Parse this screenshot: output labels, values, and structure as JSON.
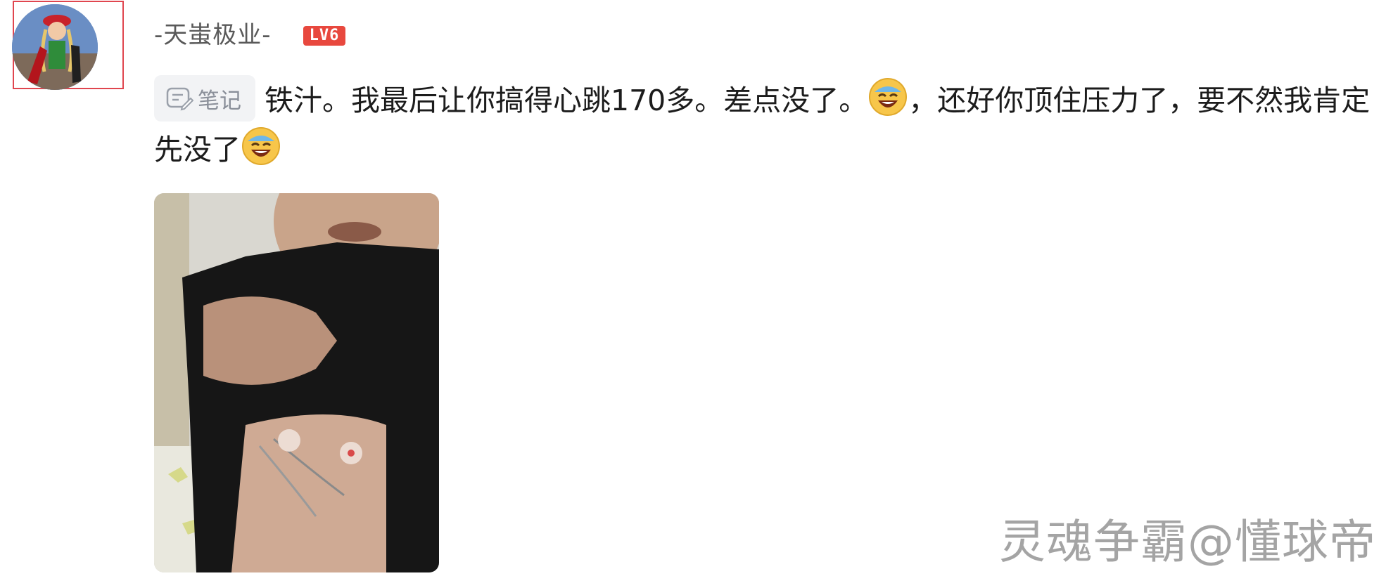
{
  "user": {
    "name": "-天蚩极业-",
    "level": "LV6",
    "avatar_icon": "avatar-cosplay-portrait"
  },
  "post": {
    "tag_label": "笔记",
    "tag_icon": "note-icon",
    "text_part_1": "铁汁。我最后让你搞得心跳170多。差点没了。",
    "text_part_2": "，还好你顶住压力了，要不然我肯定先没了",
    "emoji_name": "laughing-crying-emoji",
    "photo_description_icon": "post-photo"
  },
  "watermark": "灵魂争霸@懂球帝",
  "colors": {
    "badge": "#e8483e",
    "highlight_border": "#e0464f",
    "tag_bg": "#f2f3f5"
  }
}
